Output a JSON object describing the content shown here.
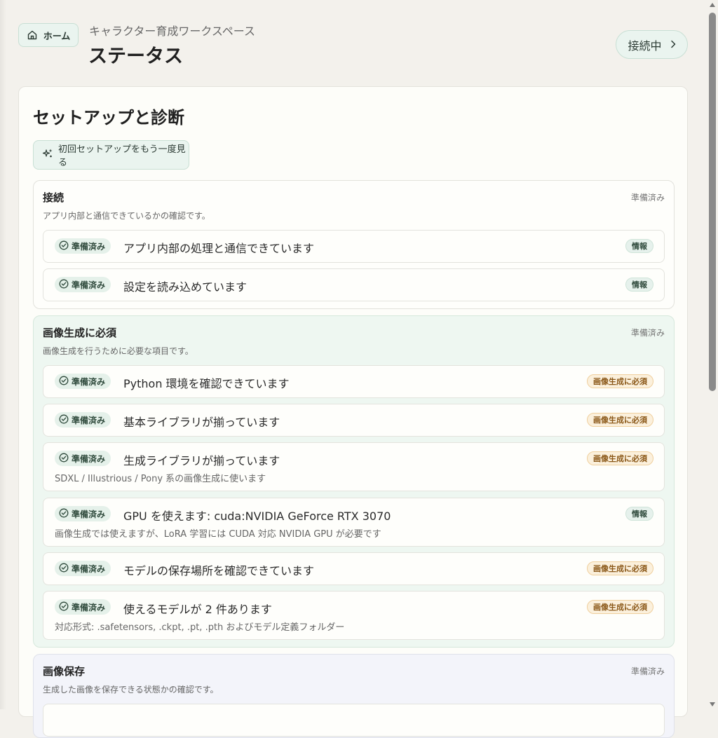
{
  "header": {
    "home_label": "ホーム",
    "workspace": "キャラクター育成ワークスペース",
    "title": "ステータス",
    "connection_label": "接続中"
  },
  "card": {
    "title": "セットアップと診断",
    "setup_button": "初回セットアップをもう一度見る"
  },
  "sections": [
    {
      "title": "接続",
      "status": "準備済み",
      "desc": "アプリ内部と通信できているかの確認です。",
      "items": [
        {
          "status": "準備済み",
          "text": "アプリ内部の処理と通信できています",
          "tag": "情報"
        },
        {
          "status": "準備済み",
          "text": "設定を読み込めています",
          "tag": "情報"
        }
      ]
    },
    {
      "title": "画像生成に必須",
      "status": "準備済み",
      "desc": "画像生成を行うために必要な項目です。",
      "items": [
        {
          "status": "準備済み",
          "text": "Python 環境を確認できています",
          "tag": "画像生成に必須"
        },
        {
          "status": "準備済み",
          "text": "基本ライブラリが揃っています",
          "tag": "画像生成に必須"
        },
        {
          "status": "準備済み",
          "text": "生成ライブラリが揃っています",
          "sub": "SDXL / Illustrious / Pony 系の画像生成に使います",
          "tag": "画像生成に必須"
        },
        {
          "status": "準備済み",
          "text": "GPU を使えます: cuda:NVIDIA GeForce RTX 3070",
          "sub": "画像生成では使えますが、LoRA 学習には CUDA 対応 NVIDIA GPU が必要です",
          "tag": "情報"
        },
        {
          "status": "準備済み",
          "text": "モデルの保存場所を確認できています",
          "tag": "画像生成に必須"
        },
        {
          "status": "準備済み",
          "text": "使えるモデルが 2 件あります",
          "sub": "対応形式: .safetensors, .ckpt, .pt, .pth およびモデル定義フォルダー",
          "tag": "画像生成に必須"
        }
      ]
    },
    {
      "title": "画像保存",
      "status": "準備済み",
      "desc": "生成した画像を保存できる状態かの確認です。"
    }
  ],
  "icons": {
    "home": "home-icon",
    "chevron": "chevron-right-icon",
    "sparkle": "sparkles-icon",
    "check": "check-circle-icon"
  },
  "colors": {
    "accent_green": "#eaf4ef",
    "tag_required": "#fbf0dc",
    "tag_required_text": "#8a5717"
  }
}
